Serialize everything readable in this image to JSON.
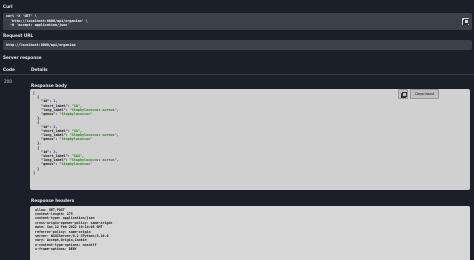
{
  "curl": {
    "label": "Curl",
    "command": "curl -X 'GET' \\\n  'http://localhost:8000/api/organism' \\\n  -H 'accept: application/json'",
    "copy_icon": "copy-icon"
  },
  "request_url": {
    "label": "Request URL",
    "value": "http://localhost:8000/api/organism"
  },
  "server_response": {
    "label": "Server response",
    "col_code": "Code",
    "col_details": "Details",
    "status_code": "200",
    "body_label": "Response body",
    "body_items": [
      {
        "id": "1",
        "short_label": "SA",
        "long_label": "Staphylococcus aureus",
        "genus": "Staphylococcus"
      },
      {
        "id": "2",
        "short_label": "SA",
        "long_label": "Staphylococcus aureus",
        "genus": "Staphylococcus"
      },
      {
        "id": "3",
        "short_label": "SA4",
        "long_label": "Staphylococcus aureus",
        "genus": "Staphylococcus"
      }
    ],
    "download_label": "Download",
    "headers_label": "Response headers",
    "headers_text": " allow: GET,POST \n content-length: 275 \n content-type: application/json \n cross-origin-opener-policy: same-origin \n date: Sat,12 Feb 2022 19:14:05 GMT \n referrer-policy: same-origin \n server: WSGIServer/0.2 CPython/3.10.0 \n vary: Accept,Origin,Cookie \n x-content-type-options: nosniff \n x-frame-options: DENY "
  }
}
